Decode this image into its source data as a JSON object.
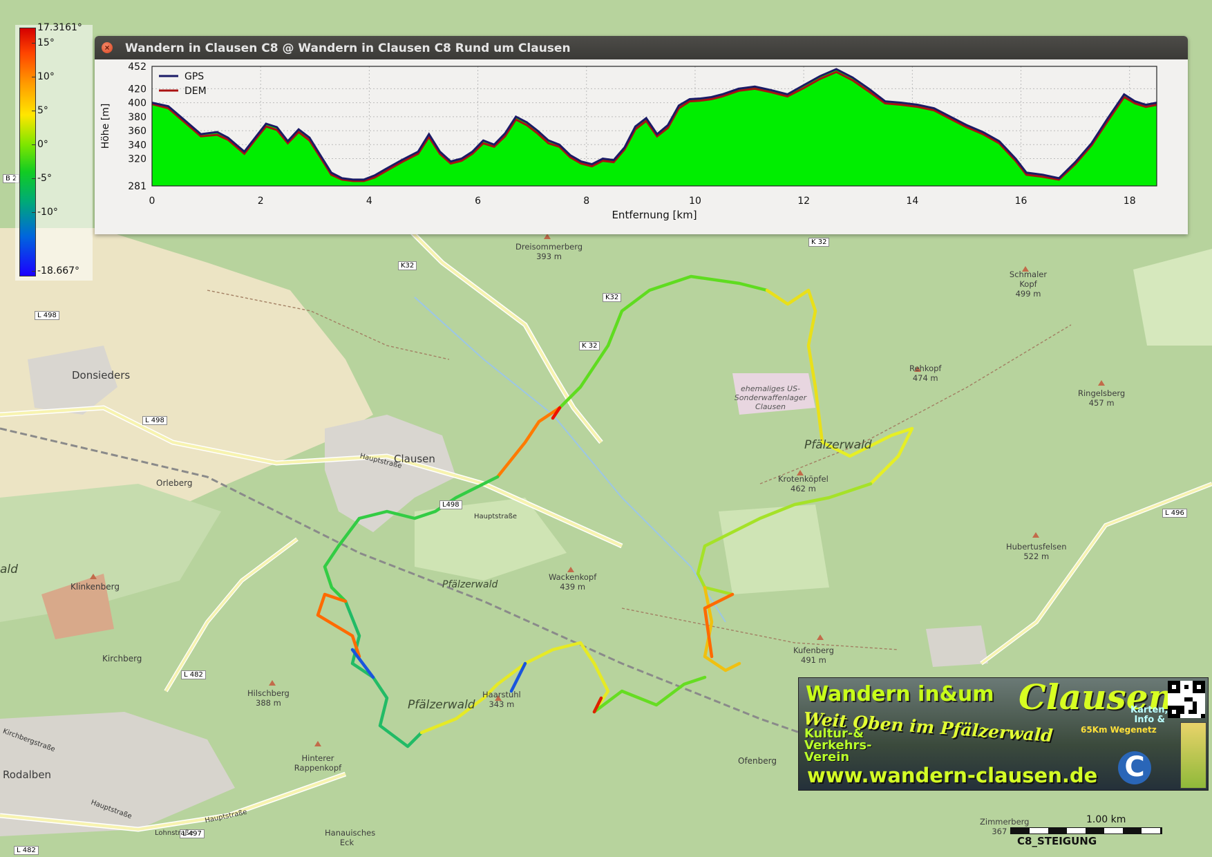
{
  "window": {
    "title": "Wandern in Clausen C8 @ Wandern in Clausen C8 Rund um Clausen",
    "close_icon": "close-icon"
  },
  "colors": {
    "profile_fill": "#00ee00",
    "gps_line": "#1a1a66",
    "dem_line": "#aa1111",
    "forest": "#b5d29a",
    "field": "#eee5c6"
  },
  "color_scale": {
    "max_label": "17.3161°",
    "min_label": "-18.667°",
    "ticks": [
      "15°",
      "10°",
      "5°",
      "0°",
      "-5°",
      "-10°"
    ]
  },
  "chart_data": {
    "type": "area",
    "xlabel": "Entfernung [km]",
    "ylabel": "Höhe [m]",
    "xlim": [
      0,
      18.5
    ],
    "ylim": [
      281,
      452
    ],
    "xticks": [
      "0",
      "2",
      "4",
      "6",
      "8",
      "10",
      "12",
      "14",
      "16",
      "18"
    ],
    "yticks": [
      "452",
      "420",
      "400",
      "380",
      "360",
      "340",
      "320",
      "281"
    ],
    "legend": "top-left",
    "grid": true,
    "series": [
      {
        "name": "GPS",
        "x": [
          0,
          0.3,
          0.6,
          0.9,
          1.2,
          1.4,
          1.7,
          1.9,
          2.1,
          2.3,
          2.5,
          2.7,
          2.9,
          3.1,
          3.3,
          3.5,
          3.7,
          3.9,
          4.1,
          4.3,
          4.6,
          4.9,
          5.1,
          5.3,
          5.5,
          5.7,
          5.9,
          6.1,
          6.3,
          6.5,
          6.7,
          6.9,
          7.1,
          7.3,
          7.5,
          7.7,
          7.9,
          8.1,
          8.3,
          8.5,
          8.7,
          8.9,
          9.1,
          9.3,
          9.5,
          9.7,
          9.9,
          10.1,
          10.3,
          10.5,
          10.8,
          11.1,
          11.4,
          11.7,
          12.0,
          12.3,
          12.6,
          12.9,
          13.2,
          13.5,
          13.8,
          14.1,
          14.4,
          14.7,
          15.0,
          15.3,
          15.6,
          15.9,
          16.1,
          16.4,
          16.7,
          17.0,
          17.3,
          17.6,
          17.9,
          18.1,
          18.3,
          18.5
        ],
        "y": [
          400,
          395,
          375,
          355,
          358,
          350,
          330,
          350,
          370,
          365,
          345,
          362,
          350,
          325,
          300,
          292,
          290,
          290,
          296,
          305,
          318,
          330,
          355,
          330,
          316,
          320,
          330,
          346,
          340,
          356,
          380,
          372,
          360,
          346,
          340,
          325,
          316,
          312,
          320,
          318,
          336,
          366,
          378,
          355,
          368,
          396,
          405,
          406,
          408,
          412,
          420,
          423,
          418,
          412,
          425,
          438,
          448,
          436,
          420,
          402,
          400,
          397,
          392,
          380,
          368,
          358,
          345,
          320,
          300,
          297,
          292,
          315,
          342,
          378,
          412,
          402,
          397,
          400
        ]
      },
      {
        "name": "DEM",
        "x": [
          0,
          0.3,
          0.6,
          0.9,
          1.2,
          1.4,
          1.7,
          1.9,
          2.1,
          2.3,
          2.5,
          2.7,
          2.9,
          3.1,
          3.3,
          3.5,
          3.7,
          3.9,
          4.1,
          4.3,
          4.6,
          4.9,
          5.1,
          5.3,
          5.5,
          5.7,
          5.9,
          6.1,
          6.3,
          6.5,
          6.7,
          6.9,
          7.1,
          7.3,
          7.5,
          7.7,
          7.9,
          8.1,
          8.3,
          8.5,
          8.7,
          8.9,
          9.1,
          9.3,
          9.5,
          9.7,
          9.9,
          10.1,
          10.3,
          10.5,
          10.8,
          11.1,
          11.4,
          11.7,
          12.0,
          12.3,
          12.6,
          12.9,
          13.2,
          13.5,
          13.8,
          14.1,
          14.4,
          14.7,
          15.0,
          15.3,
          15.6,
          15.9,
          16.1,
          16.4,
          16.7,
          17.0,
          17.3,
          17.6,
          17.9,
          18.1,
          18.3,
          18.5
        ],
        "y": [
          398,
          392,
          372,
          352,
          354,
          347,
          327,
          347,
          366,
          361,
          342,
          358,
          346,
          322,
          297,
          290,
          288,
          288,
          293,
          302,
          315,
          327,
          351,
          327,
          313,
          317,
          327,
          342,
          337,
          352,
          376,
          368,
          356,
          342,
          337,
          322,
          313,
          309,
          317,
          315,
          333,
          362,
          374,
          352,
          364,
          392,
          402,
          403,
          405,
          409,
          417,
          420,
          415,
          409,
          421,
          434,
          444,
          432,
          416,
          399,
          397,
          394,
          389,
          377,
          365,
          355,
          342,
          317,
          297,
          294,
          290,
          312,
          339,
          374,
          408,
          399,
          394,
          397
        ]
      }
    ]
  },
  "map": {
    "towns": [
      "Donsieders",
      "Clausen",
      "Orleberg",
      "Rodalben",
      "Kirchberg",
      "Klinkenberg",
      "Ofenberg"
    ],
    "forest_labels": [
      "Pfälzerwald",
      "Pfälzerwald",
      "Pfälzerwald",
      "ald"
    ],
    "peaks": [
      {
        "name": "Dreisommerberg",
        "elev": "393 m"
      },
      {
        "name": "Schmaler Kopf",
        "elev": "499 m"
      },
      {
        "name": "Rehkopf",
        "elev": "474 m"
      },
      {
        "name": "Ringelsberg",
        "elev": "457 m"
      },
      {
        "name": "Krotenköpfel",
        "elev": "462 m"
      },
      {
        "name": "Hubertusfelsen",
        "elev": "522 m"
      },
      {
        "name": "Wackenkopf",
        "elev": "439 m"
      },
      {
        "name": "Kufenberg",
        "elev": "491 m"
      },
      {
        "name": "Hilschberg",
        "elev": "388 m"
      },
      {
        "name": "Haarstuhl",
        "elev": "343 m"
      },
      {
        "name": "Hinterer Rappenkopf",
        "elev": ""
      },
      {
        "name": "Zimmerberg",
        "elev": "367 m"
      },
      {
        "name": "Hanauisches Eck",
        "elev": ""
      }
    ],
    "roads": [
      "K 32",
      "K32",
      "K32",
      "K 32",
      "L 498",
      "L 498",
      "L498",
      "L 482",
      "L 497",
      "L 482",
      "L 496",
      "B 2",
      "Hauptstraße",
      "Hauptstraße",
      "Hauptstraße",
      "Hauptstraße",
      "Lohnstraße",
      "Kirchbergstraße"
    ],
    "landmark": "ehemaliges US-Sonderwaffenlager Clausen"
  },
  "banner": {
    "line1": "Wandern in&um",
    "line2": "Clausen",
    "slogan": "Weit Oben im Pfälzerwald",
    "org": "Kultur-& Verkehrs- Verein",
    "network": "65Km Wegenetz",
    "info": "Karten, Info &",
    "url": "www.wandern-clausen.de",
    "logo_letter": "C"
  },
  "scale_bar": {
    "distance": "1.00 km",
    "track_name": "C8_STEIGUNG"
  }
}
